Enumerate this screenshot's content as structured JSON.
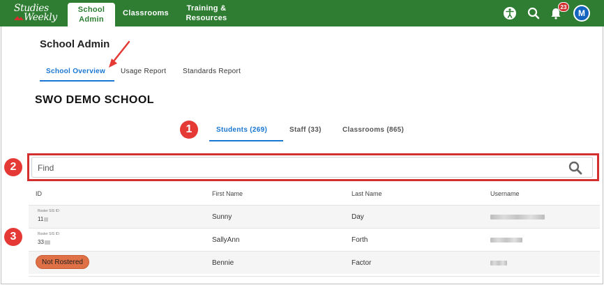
{
  "logo": {
    "line1": "Studies",
    "line2": "Weekly"
  },
  "topnav": {
    "tabs": [
      {
        "label": "School Admin",
        "active": true
      },
      {
        "label": "Classrooms",
        "active": false
      },
      {
        "label": "Training & Resources",
        "active": false
      }
    ],
    "icons": [
      "accessibility-icon",
      "search-icon",
      "bell-icon"
    ],
    "notification_count": "23",
    "avatar_initial": "M",
    "colors": {
      "nav_bg": "#2e7d32",
      "avatar_bg": "#1565c0",
      "badge_bg": "#d32f2f"
    }
  },
  "page": {
    "title": "School Admin",
    "subtabs": [
      {
        "label": "School Overview",
        "active": true
      },
      {
        "label": "Usage Report",
        "active": false
      },
      {
        "label": "Standards Report",
        "active": false
      }
    ],
    "school_name": "SWO DEMO SCHOOL",
    "people_tabs": [
      {
        "label": "Students (269)",
        "active": true
      },
      {
        "label": "Staff (33)",
        "active": false
      },
      {
        "label": "Classrooms (865)",
        "active": false
      }
    ]
  },
  "callouts": [
    "1",
    "2",
    "3"
  ],
  "search": {
    "placeholder": "Find",
    "value": ""
  },
  "table": {
    "headers": [
      "ID",
      "First Name",
      "Last Name",
      "Username"
    ],
    "rows": [
      {
        "sis_label": "Roster SIS ID:",
        "sis_id": "11",
        "first": "Sunny",
        "last": "Day",
        "rostered": true
      },
      {
        "sis_label": "Roster SIS ID:",
        "sis_id": "33",
        "first": "SallyAnn",
        "last": "Forth",
        "rostered": true
      },
      {
        "status": "Not Rostered",
        "first": "Bennie",
        "last": "Factor",
        "rostered": false
      }
    ]
  },
  "accent": {
    "blue": "#1976d2",
    "callout_red": "#e53935",
    "pill_orange": "#e07045"
  }
}
